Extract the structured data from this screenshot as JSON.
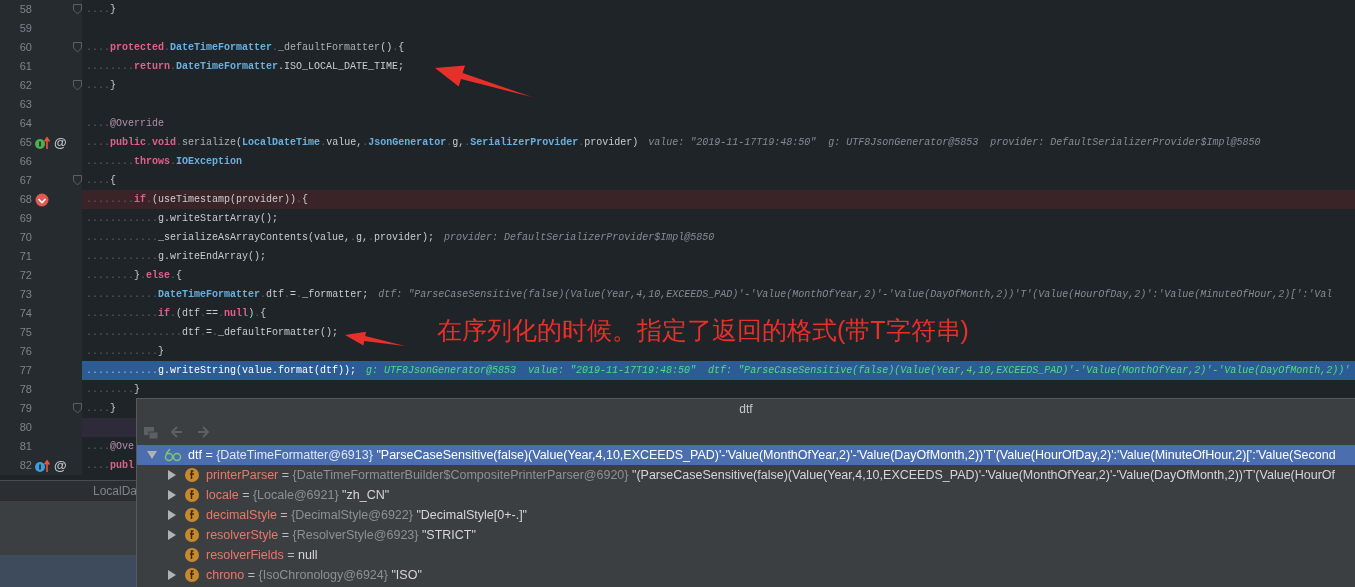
{
  "editor": {
    "lines": [
      {
        "number": "58",
        "kind": "plain",
        "fold": true,
        "tokens": [
          {
            "kind": "ws",
            "t": "...."
          },
          {
            "kind": "plain",
            "t": "}"
          }
        ]
      },
      {
        "number": "59",
        "kind": "plain",
        "fold": false
      },
      {
        "number": "60",
        "kind": "plain",
        "fold": true,
        "tokens": [
          {
            "kind": "ws",
            "t": "...."
          },
          {
            "kind": "kw",
            "t": "protected"
          },
          {
            "kind": "ws",
            "t": "."
          },
          {
            "kind": "type",
            "t": "DateTimeFormatter"
          },
          {
            "kind": "ws",
            "t": "."
          },
          {
            "kind": "dim",
            "t": "_defaultFormatter"
          },
          {
            "kind": "plain",
            "t": "()"
          },
          {
            "kind": "ws",
            "t": "."
          },
          {
            "kind": "plain",
            "t": "{"
          }
        ]
      },
      {
        "number": "61",
        "kind": "plain",
        "fold": false,
        "tokens": [
          {
            "kind": "ws",
            "t": "........"
          },
          {
            "kind": "kw",
            "t": "return"
          },
          {
            "kind": "ws",
            "t": "."
          },
          {
            "kind": "type",
            "t": "DateTimeFormatter"
          },
          {
            "kind": "plain",
            "t": ".ISO_LOCAL_DATE_TIME;"
          }
        ]
      },
      {
        "number": "62",
        "kind": "plain",
        "fold": true,
        "tokens": [
          {
            "kind": "ws",
            "t": "...."
          },
          {
            "kind": "plain",
            "t": "}"
          }
        ]
      },
      {
        "number": "63",
        "kind": "plain",
        "fold": false
      },
      {
        "number": "64",
        "kind": "plain",
        "fold": false,
        "tokens": [
          {
            "kind": "ws",
            "t": "...."
          },
          {
            "kind": "annot",
            "t": "@Override"
          }
        ]
      },
      {
        "number": "65",
        "kind": "plain",
        "fold": false,
        "gutter": [
          {
            "kind": "implements"
          },
          {
            "kind": "at",
            "text": "@"
          }
        ],
        "tokens": [
          {
            "kind": "ws",
            "t": "...."
          },
          {
            "kind": "kw",
            "t": "public"
          },
          {
            "kind": "ws",
            "t": "."
          },
          {
            "kind": "kw",
            "t": "void"
          },
          {
            "kind": "ws",
            "t": "."
          },
          {
            "kind": "dim",
            "t": "serialize"
          },
          {
            "kind": "plain",
            "t": "("
          },
          {
            "kind": "type",
            "t": "LocalDateTime"
          },
          {
            "kind": "ws",
            "t": "."
          },
          {
            "kind": "plain",
            "t": "value,"
          },
          {
            "kind": "ws",
            "t": "."
          },
          {
            "kind": "type",
            "t": "JsonGenerator"
          },
          {
            "kind": "ws",
            "t": "."
          },
          {
            "kind": "plain",
            "t": "g,"
          },
          {
            "kind": "ws",
            "t": "."
          },
          {
            "kind": "type",
            "t": "SerializerProvider"
          },
          {
            "kind": "ws",
            "t": "."
          },
          {
            "kind": "plain",
            "t": "provider)"
          }
        ],
        "hint": "value: \"2019-11-17T19:48:50\"  g: UTF8JsonGenerator@5853  provider: DefaultSerializerProvider$Impl@5850"
      },
      {
        "number": "66",
        "kind": "plain",
        "fold": false,
        "tokens": [
          {
            "kind": "ws",
            "t": "........"
          },
          {
            "kind": "kw",
            "t": "throws"
          },
          {
            "kind": "ws",
            "t": "."
          },
          {
            "kind": "type",
            "t": "IOException"
          }
        ]
      },
      {
        "number": "67",
        "kind": "plain",
        "fold": true,
        "tokens": [
          {
            "kind": "ws",
            "t": "...."
          },
          {
            "kind": "plain",
            "t": "{"
          }
        ]
      },
      {
        "number": "68",
        "kind": "breakpoint",
        "fold": false,
        "gutter": [
          {
            "kind": "breakpoint"
          }
        ],
        "tokens": [
          {
            "kind": "ws",
            "t": "........"
          },
          {
            "kind": "kw",
            "t": "if"
          },
          {
            "kind": "ws",
            "t": "."
          },
          {
            "kind": "plain",
            "t": "(useTimestamp(provider))"
          },
          {
            "kind": "ws",
            "t": "."
          },
          {
            "kind": "plain",
            "t": "{"
          }
        ]
      },
      {
        "number": "69",
        "kind": "plain",
        "fold": false,
        "tokens": [
          {
            "kind": "ws",
            "t": "............"
          },
          {
            "kind": "plain",
            "t": "g.writeStartArray();"
          }
        ]
      },
      {
        "number": "70",
        "kind": "plain",
        "fold": false,
        "tokens": [
          {
            "kind": "ws",
            "t": "............"
          },
          {
            "kind": "plain",
            "t": "_serializeAsArrayContents(value,"
          },
          {
            "kind": "ws",
            "t": "."
          },
          {
            "kind": "plain",
            "t": "g,"
          },
          {
            "kind": "ws",
            "t": "."
          },
          {
            "kind": "plain",
            "t": "provider);"
          }
        ],
        "hint": "provider: DefaultSerializerProvider$Impl@5850"
      },
      {
        "number": "71",
        "kind": "plain",
        "fold": false,
        "tokens": [
          {
            "kind": "ws",
            "t": "............"
          },
          {
            "kind": "plain",
            "t": "g.writeEndArray();"
          }
        ]
      },
      {
        "number": "72",
        "kind": "plain",
        "fold": false,
        "tokens": [
          {
            "kind": "ws",
            "t": "........"
          },
          {
            "kind": "plain",
            "t": "}"
          },
          {
            "kind": "ws",
            "t": "."
          },
          {
            "kind": "kw",
            "t": "else"
          },
          {
            "kind": "ws",
            "t": "."
          },
          {
            "kind": "plain",
            "t": "{"
          }
        ]
      },
      {
        "number": "73",
        "kind": "plain",
        "fold": false,
        "tokens": [
          {
            "kind": "ws",
            "t": "............"
          },
          {
            "kind": "type",
            "t": "DateTimeFormatter"
          },
          {
            "kind": "ws",
            "t": "."
          },
          {
            "kind": "plain",
            "t": "dtf"
          },
          {
            "kind": "ws",
            "t": "."
          },
          {
            "kind": "plain",
            "t": "="
          },
          {
            "kind": "ws",
            "t": "."
          },
          {
            "kind": "plain",
            "t": "_formatter;"
          }
        ],
        "hint": "dtf: \"ParseCaseSensitive(false)(Value(Year,4,10,EXCEEDS_PAD)'-'Value(MonthOfYear,2)'-'Value(DayOfMonth,2))'T'(Value(HourOfDay,2)':'Value(MinuteOfHour,2)[':'Val"
      },
      {
        "number": "74",
        "kind": "plain",
        "fold": false,
        "tokens": [
          {
            "kind": "ws",
            "t": "............"
          },
          {
            "kind": "kw",
            "t": "if"
          },
          {
            "kind": "ws",
            "t": "."
          },
          {
            "kind": "plain",
            "t": "(dtf"
          },
          {
            "kind": "ws",
            "t": "."
          },
          {
            "kind": "plain",
            "t": "=="
          },
          {
            "kind": "ws",
            "t": "."
          },
          {
            "kind": "kw",
            "t": "null"
          },
          {
            "kind": "plain",
            "t": ")"
          },
          {
            "kind": "ws",
            "t": "."
          },
          {
            "kind": "plain",
            "t": "{"
          }
        ]
      },
      {
        "number": "75",
        "kind": "plain",
        "fold": false,
        "tokens": [
          {
            "kind": "ws",
            "t": "................"
          },
          {
            "kind": "plain",
            "t": "dtf"
          },
          {
            "kind": "ws",
            "t": "."
          },
          {
            "kind": "plain",
            "t": "="
          },
          {
            "kind": "ws",
            "t": "."
          },
          {
            "kind": "plain",
            "t": "_defaultFormatter();"
          }
        ]
      },
      {
        "number": "76",
        "kind": "plain",
        "fold": false,
        "tokens": [
          {
            "kind": "ws",
            "t": "............"
          },
          {
            "kind": "plain",
            "t": "}"
          }
        ]
      },
      {
        "number": "77",
        "kind": "current",
        "fold": false,
        "tokens": [
          {
            "kind": "ws",
            "t": "............"
          },
          {
            "kind": "plain",
            "t": "g.writeString(value.format(dtf));"
          }
        ],
        "hint": "g: UTF8JsonGenerator@5853  value: \"2019-11-17T19:48:50\"  dtf: \"ParseCaseSensitive(false)(Value(Year,4,10,EXCEEDS_PAD)'-'Value(MonthOfYear,2)'-'Value(DayOfMonth,2))'"
      },
      {
        "number": "78",
        "kind": "plain",
        "fold": false,
        "tokens": [
          {
            "kind": "ws",
            "t": "........"
          },
          {
            "kind": "plain",
            "t": "}"
          }
        ]
      },
      {
        "number": "79",
        "kind": "plain",
        "fold": true,
        "tokens": [
          {
            "kind": "ws",
            "t": "...."
          },
          {
            "kind": "plain",
            "t": "}"
          }
        ]
      },
      {
        "number": "80",
        "kind": "caret",
        "fold": false
      },
      {
        "number": "81",
        "kind": "plain",
        "fold": false,
        "tokens": [
          {
            "kind": "ws",
            "t": "...."
          },
          {
            "kind": "annot",
            "t": "@Ove"
          }
        ]
      },
      {
        "number": "82",
        "kind": "plain",
        "fold": false,
        "gutter": [
          {
            "kind": "overridden"
          },
          {
            "kind": "at",
            "text": "@"
          }
        ],
        "tokens": [
          {
            "kind": "ws",
            "t": "...."
          },
          {
            "kind": "kw",
            "t": "publ"
          }
        ]
      }
    ],
    "breadcrumb": "LocalDa"
  },
  "annotation": {
    "note": "在序列化的时候。指定了返回的格式(带T字符串)"
  },
  "popup": {
    "title": "dtf",
    "toolbar": [
      {
        "kind": "stack",
        "disabled": true
      },
      {
        "kind": "back",
        "disabled": true
      },
      {
        "kind": "forward",
        "disabled": true
      }
    ],
    "tree": [
      {
        "kind": "watch",
        "name": "dtf",
        "op": "=",
        "ref": "{DateTimeFormatter@6913}",
        "value": "\"ParseCaseSensitive(false)(Value(Year,4,10,EXCEEDS_PAD)'-'Value(MonthOfYear,2)'-'Value(DayOfMonth,2))'T'(Value(HourOfDay,2)':'Value(MinuteOfHour,2)[':'Value(Second",
        "expandable": true,
        "expanded": true,
        "selected": true,
        "children": [
          {
            "kind": "field",
            "name": "printerParser",
            "op": "=",
            "ref": "{DateTimeFormatterBuilder$CompositePrinterParser@6920}",
            "value": "\"(ParseCaseSensitive(false)(Value(Year,4,10,EXCEEDS_PAD)'-'Value(MonthOfYear,2)'-'Value(DayOfMonth,2))'T'(Value(HourOf",
            "expandable": true,
            "expanded": false,
            "selected": false
          },
          {
            "kind": "field",
            "name": "locale",
            "op": "=",
            "ref": "{Locale@6921}",
            "value": "\"zh_CN\"",
            "expandable": true,
            "expanded": false,
            "selected": false
          },
          {
            "kind": "field",
            "name": "decimalStyle",
            "op": "=",
            "ref": "{DecimalStyle@6922}",
            "value": "\"DecimalStyle[0+-.]\"",
            "expandable": true,
            "expanded": false,
            "selected": false
          },
          {
            "kind": "field",
            "name": "resolverStyle",
            "op": "=",
            "ref": "{ResolverStyle@6923}",
            "value": "\"STRICT\"",
            "expandable": true,
            "expanded": false,
            "selected": false
          },
          {
            "kind": "field",
            "name": "resolverFields",
            "op": "=",
            "value": "null",
            "expandable": false,
            "expanded": false,
            "selected": false
          },
          {
            "kind": "field",
            "name": "chrono",
            "op": "=",
            "ref": "{IsoChronology@6924}",
            "value": "\"ISO\"",
            "expandable": true,
            "expanded": false,
            "selected": false
          }
        ]
      }
    ]
  }
}
